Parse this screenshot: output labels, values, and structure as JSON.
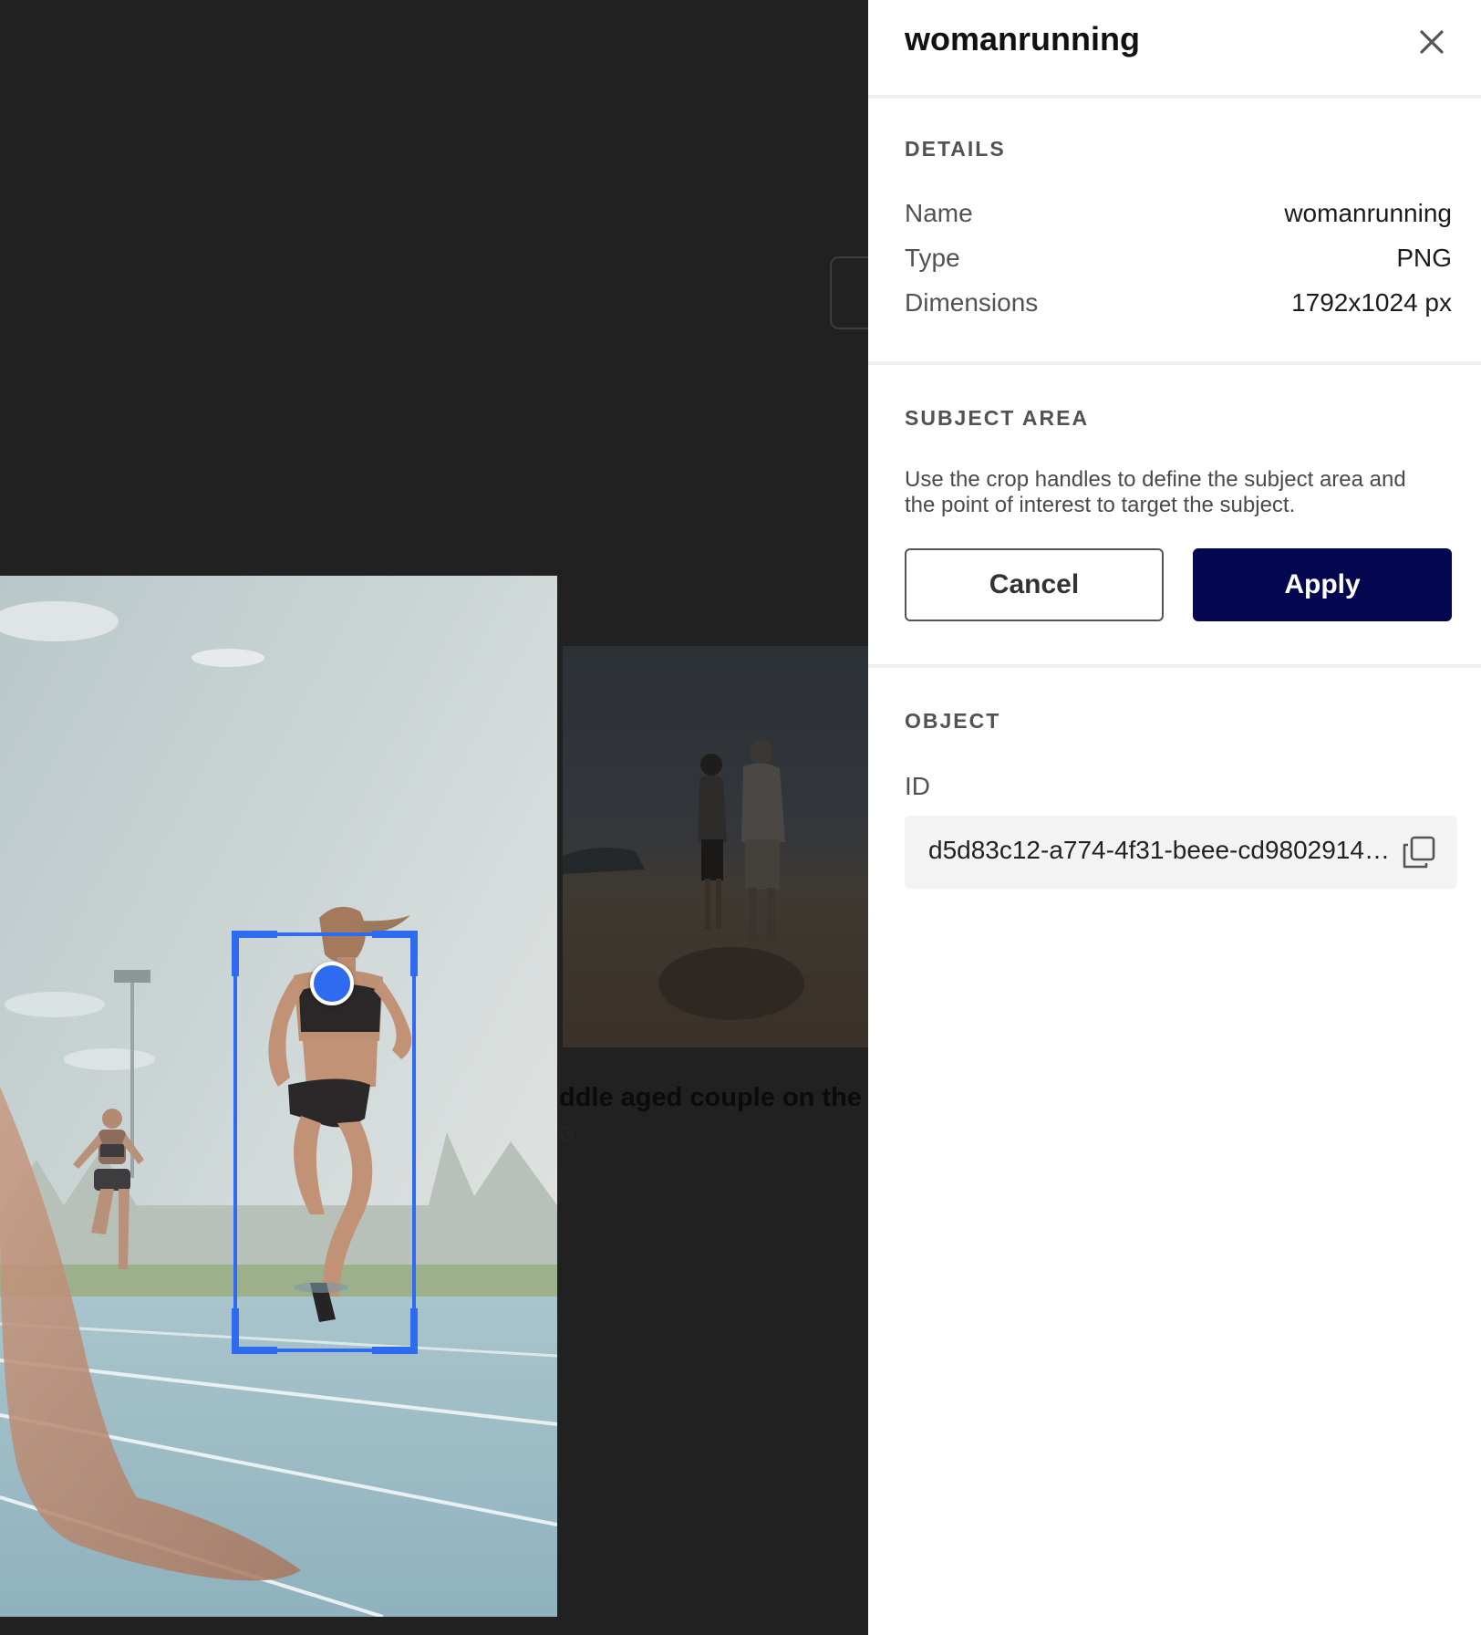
{
  "panel": {
    "title": "womanrunning",
    "close_icon": "close-icon",
    "details": {
      "heading": "DETAILS",
      "rows": [
        {
          "label": "Name",
          "value": "womanrunning"
        },
        {
          "label": "Type",
          "value": "PNG"
        },
        {
          "label": "Dimensions",
          "value": "1792x1024 px"
        }
      ]
    },
    "subject_area": {
      "heading": "SUBJECT AREA",
      "help": "Use the crop handles to define the subject area and the point of interest to target the subject.",
      "cancel_label": "Cancel",
      "apply_label": "Apply",
      "apply_color": "#050650",
      "accent_color": "#2f6bf1"
    },
    "object": {
      "heading": "OBJECT",
      "id_label": "ID",
      "id_value": "d5d83c12-a774-4f31-beee-cd9802914…",
      "copy_icon": "copy-icon"
    }
  },
  "background": {
    "side_card_title": "ddle aged couple on the be",
    "side_card_subtitle": "G"
  }
}
